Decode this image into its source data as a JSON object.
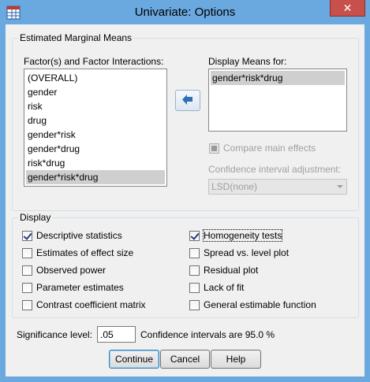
{
  "window": {
    "title": "Univariate: Options",
    "close_symbol": "✕"
  },
  "emm": {
    "legend": "Estimated Marginal Means",
    "factors_label": "Factor(s) and Factor Interactions:",
    "factors": [
      "(OVERALL)",
      "gender",
      "risk",
      "drug",
      "gender*risk",
      "gender*drug",
      "risk*drug",
      "gender*risk*drug"
    ],
    "factors_selected_index": 7,
    "display_means_label": "Display Means for:",
    "display_means": [
      "gender*risk*drug"
    ],
    "compare_main_effects": {
      "label": "Compare main effects",
      "checked": false,
      "enabled": false
    },
    "ci_adjustment_label": "Confidence interval adjustment:",
    "ci_adjustment_value": "LSD(none)",
    "arrow_icon": "move-right-arrow-icon"
  },
  "display": {
    "legend": "Display",
    "left": [
      {
        "label": "Descriptive statistics",
        "checked": true
      },
      {
        "label": "Estimates of effect size",
        "checked": false
      },
      {
        "label": "Observed power",
        "checked": false
      },
      {
        "label": "Parameter estimates",
        "checked": false
      },
      {
        "label": "Contrast coefficient matrix",
        "checked": false
      }
    ],
    "right": [
      {
        "label": "Homogeneity tests",
        "checked": true
      },
      {
        "label": "Spread vs. level plot",
        "checked": false
      },
      {
        "label": "Residual plot",
        "checked": false
      },
      {
        "label": "Lack of fit",
        "checked": false
      },
      {
        "label": "General estimable function",
        "checked": false
      }
    ]
  },
  "significance": {
    "label": "Significance level:",
    "value": ".05",
    "ci_text": "Confidence intervals are 95.0 %"
  },
  "buttons": {
    "continue": "Continue",
    "cancel": "Cancel",
    "help": "Help"
  },
  "colors": {
    "window_frame": "#6aa8e0",
    "close_button": "#c7504a",
    "selection": "#cfcfcf"
  }
}
